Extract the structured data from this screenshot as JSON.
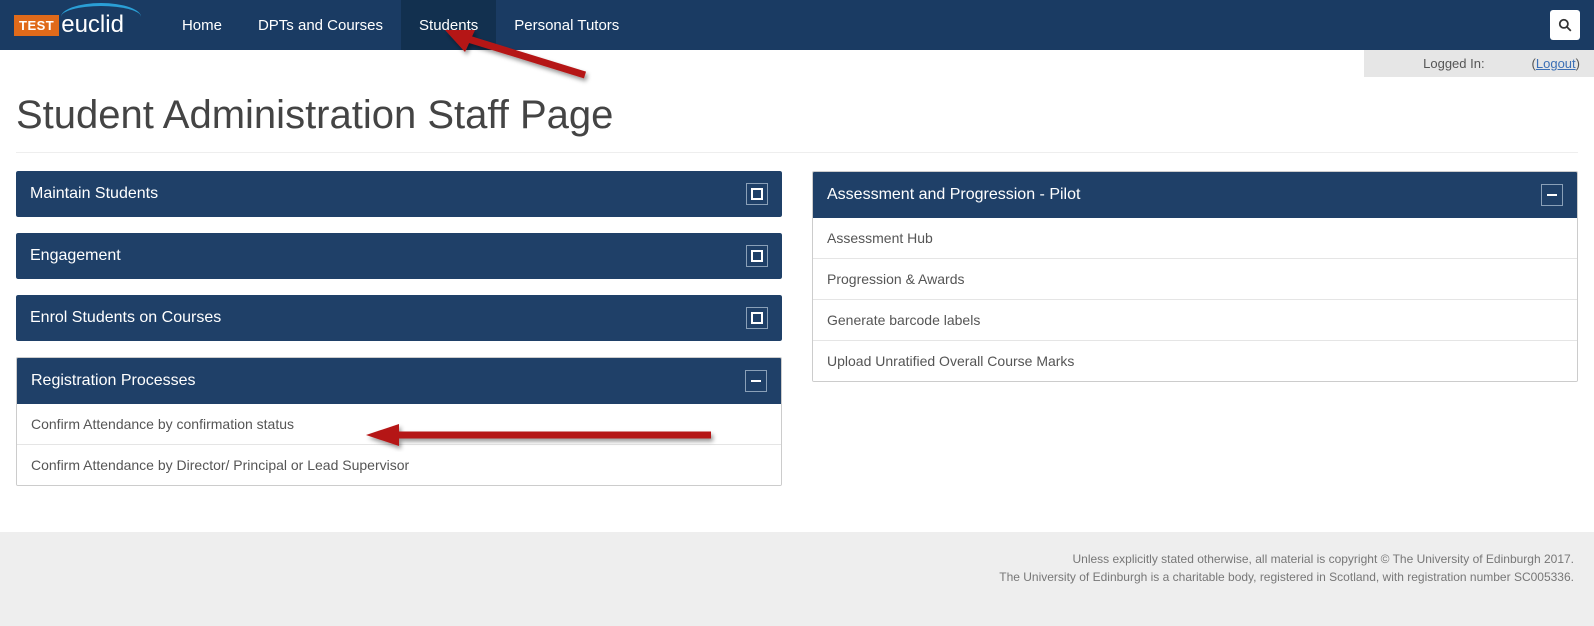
{
  "nav": {
    "items": [
      "Home",
      "DPTs and Courses",
      "Students",
      "Personal Tutors"
    ],
    "active_index": 2
  },
  "logo": {
    "test": "TEST",
    "name": "euclid"
  },
  "login": {
    "label": "Logged In:",
    "logout": "Logout"
  },
  "page_title": "Student Administration Staff Page",
  "left_panels": [
    {
      "title": "Maintain Students",
      "state": "collapsed",
      "items": []
    },
    {
      "title": "Engagement",
      "state": "collapsed",
      "items": []
    },
    {
      "title": "Enrol Students on Courses",
      "state": "collapsed",
      "items": []
    },
    {
      "title": "Registration Processes",
      "state": "expanded",
      "items": [
        "Confirm Attendance by confirmation status",
        "Confirm Attendance by Director/ Principal or Lead Supervisor"
      ]
    }
  ],
  "right_panels": [
    {
      "title": "Assessment and Progression - Pilot",
      "state": "expanded",
      "items": [
        "Assessment Hub",
        "Progression & Awards",
        "Generate barcode labels",
        "Upload Unratified Overall Course Marks"
      ]
    }
  ],
  "footer": {
    "line1": "Unless explicitly stated otherwise, all material is copyright © The University of Edinburgh 2017.",
    "line2": "The University of Edinburgh is a charitable body, registered in Scotland, with registration number SC005336."
  }
}
